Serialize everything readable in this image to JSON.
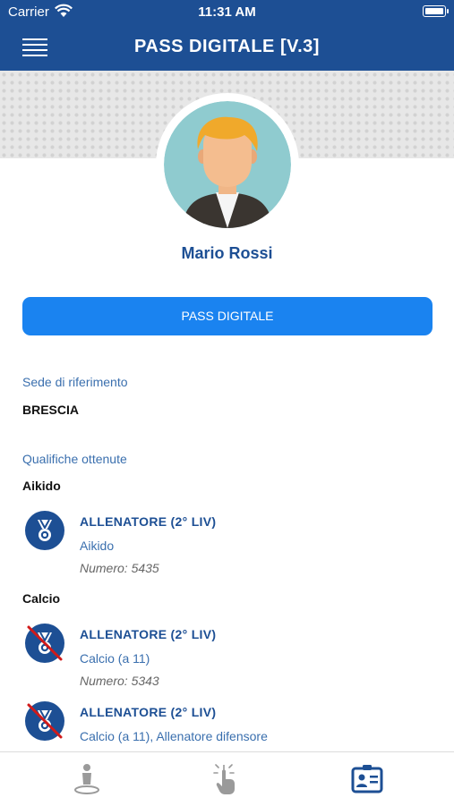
{
  "status_bar": {
    "carrier": "Carrier",
    "time": "11:31 AM"
  },
  "nav": {
    "title": "PASS DIGITALE [V.3]",
    "menu_icon": "hamburger-menu-icon"
  },
  "profile": {
    "name": "Mario Rossi",
    "avatar_icon": "user-avatar-icon"
  },
  "pass_button": {
    "label": "PASS DIGITALE"
  },
  "sede": {
    "label": "Sede di riferimento",
    "value": "BRESCIA"
  },
  "qualifiche": {
    "label": "Qualifiche ottenute",
    "groups": [
      {
        "sport": "Aikido"
      },
      {
        "sport": "Calcio"
      }
    ],
    "items": [
      {
        "title": "ALLENATORE (2° LIV)",
        "subtitle": "Aikido",
        "number": "Numero: 5435",
        "icon": "medal-icon",
        "status": "valid"
      },
      {
        "title": "ALLENATORE (2° LIV)",
        "subtitle": "Calcio (a 11)",
        "number": "Numero: 5343",
        "icon": "medal-crossed-icon",
        "status": "expired"
      },
      {
        "title": "ALLENATORE (2° LIV)",
        "subtitle": "Calcio (a 11), Allenatore difensore",
        "icon": "medal-crossed-icon",
        "status": "expired"
      }
    ]
  },
  "tab_bar": {
    "tabs": [
      {
        "name": "location-person-icon",
        "active": false
      },
      {
        "name": "tap-hand-icon",
        "active": false
      },
      {
        "name": "id-card-icon",
        "active": true
      }
    ]
  },
  "colors": {
    "primary": "#1d4f94",
    "button": "#1a83f0",
    "crossed": "#d11a1a",
    "inactive": "#9a9a9a"
  }
}
